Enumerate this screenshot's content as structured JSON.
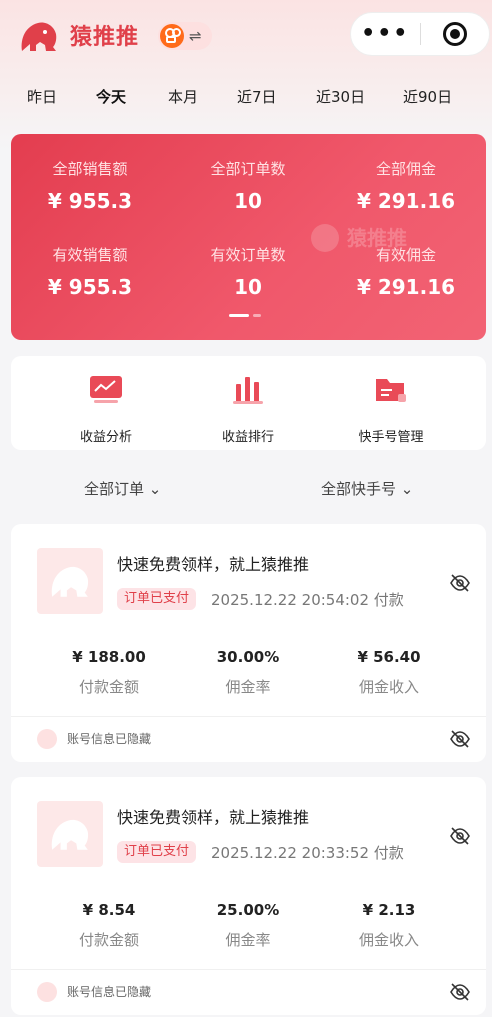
{
  "app": {
    "name": "猿推推",
    "switch_arrows": "⇌",
    "capsule_dots": "•••"
  },
  "tabs": [
    {
      "label": "昨日",
      "active": false
    },
    {
      "label": "今天",
      "active": true
    },
    {
      "label": "本月",
      "active": false
    },
    {
      "label": "近7日",
      "active": false
    },
    {
      "label": "近30日",
      "active": false
    },
    {
      "label": "近90日",
      "active": false
    }
  ],
  "stats": {
    "watermark": "猿推推",
    "items": [
      {
        "label": "全部销售额",
        "value": "¥ 955.3"
      },
      {
        "label": "全部订单数",
        "value": "10"
      },
      {
        "label": "全部佣金",
        "value": "¥ 291.16"
      },
      {
        "label": "有效销售额",
        "value": "¥ 955.3"
      },
      {
        "label": "有效订单数",
        "value": "10"
      },
      {
        "label": "有效佣金",
        "value": "¥ 291.16"
      }
    ]
  },
  "tools": [
    {
      "label": "收益分析",
      "icon": "analytics-icon"
    },
    {
      "label": "收益排行",
      "icon": "ranking-icon"
    },
    {
      "label": "快手号管理",
      "icon": "folder-manage-icon"
    }
  ],
  "filters": {
    "orders": "全部订单 ⌄",
    "accounts": "全部快手号 ⌄"
  },
  "orders": [
    {
      "title": "快速免费领样，就上猿推推",
      "status": "订单已支付",
      "time": "2025.12.22 20:54:02  付款",
      "amount": "¥ 188.00",
      "amount_label": "付款金额",
      "rate": "30.00%",
      "rate_label": "佣金率",
      "commission": "¥ 56.40",
      "commission_label": "佣金收入",
      "account": "账号信息已隐藏"
    },
    {
      "title": "快速免费领样，就上猿推推",
      "status": "订单已支付",
      "time": "2025.12.22 20:33:52  付款",
      "amount": "¥ 8.54",
      "amount_label": "付款金额",
      "rate": "25.00%",
      "rate_label": "佣金率",
      "commission": "¥ 2.13",
      "commission_label": "佣金收入",
      "account": "账号信息已隐藏"
    }
  ],
  "colors": {
    "brand": "#e0404a",
    "card_gradient_start": "#e33d4f",
    "card_gradient_end": "#f26374"
  }
}
